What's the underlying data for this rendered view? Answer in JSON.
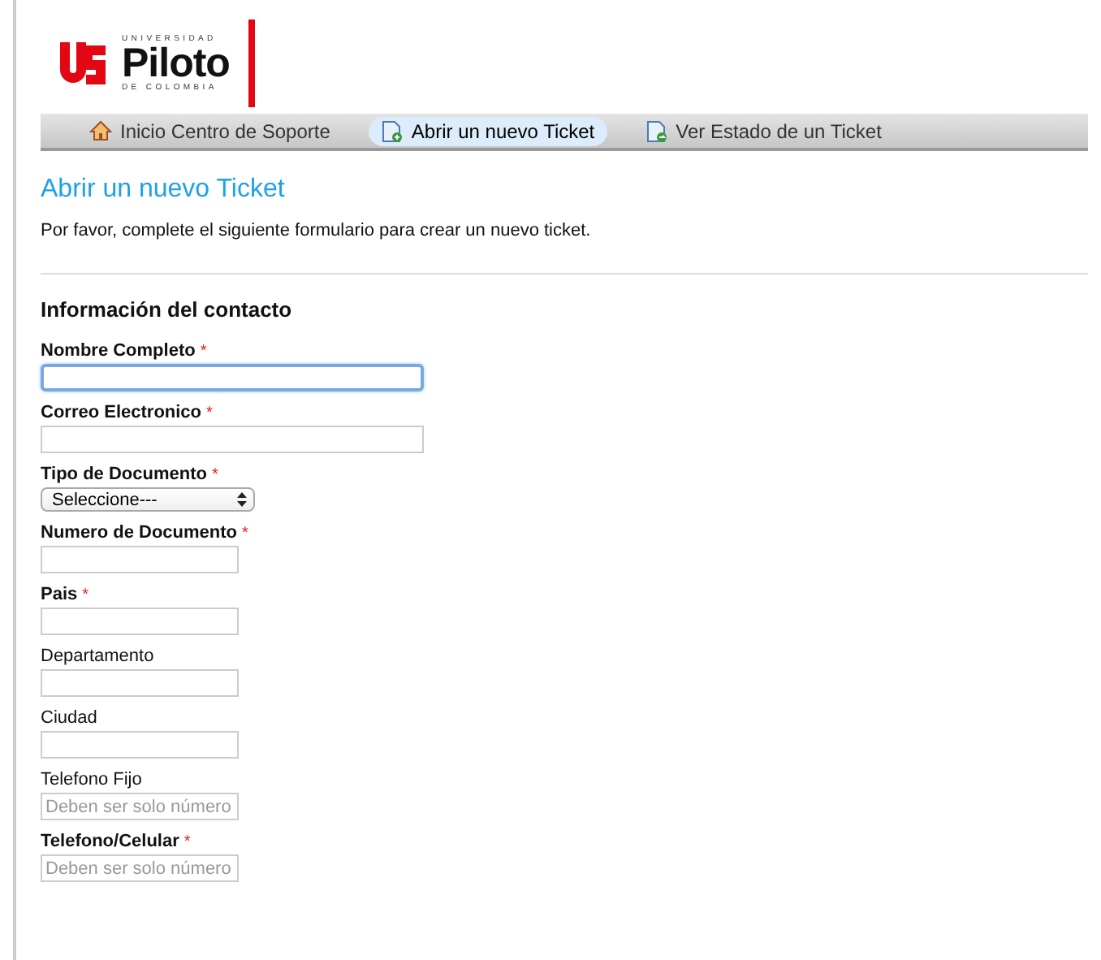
{
  "logo": {
    "top": "UNIVERSIDAD",
    "name": "Piloto",
    "bottom": "DE COLOMBIA"
  },
  "nav": [
    {
      "label": "Inicio Centro de Soporte",
      "kind": "home",
      "selected": false
    },
    {
      "label": "Abrir un nuevo Ticket",
      "kind": "new",
      "selected": true
    },
    {
      "label": "Ver Estado de un Ticket",
      "kind": "status",
      "selected": false
    }
  ],
  "page_title": "Abrir un nuevo Ticket",
  "intro": "Por favor, complete el siguiente formulario para crear un nuevo ticket.",
  "section_title": "Información del contacto",
  "fields": [
    {
      "label": "Nombre Completo",
      "required": true,
      "kind": "wide",
      "focused": true
    },
    {
      "label": "Correo Electronico",
      "required": true,
      "kind": "wide",
      "focused": false
    },
    {
      "label": "Tipo de Documento",
      "required": true,
      "kind": "select",
      "value": "Seleccione---",
      "focused": false
    },
    {
      "label": "Numero de Documento",
      "required": true,
      "kind": "narrow",
      "focused": false
    },
    {
      "label": "Pais",
      "required": true,
      "kind": "narrow",
      "focused": false
    },
    {
      "label": "Departamento",
      "required": false,
      "kind": "narrow",
      "focused": false
    },
    {
      "label": "Ciudad",
      "required": false,
      "kind": "narrow",
      "focused": false
    },
    {
      "label": "Telefono Fijo",
      "required": false,
      "kind": "narrow",
      "focused": false,
      "placeholder": "Deben ser solo número"
    },
    {
      "label": "Telefono/Celular",
      "required": true,
      "kind": "narrow",
      "focused": false,
      "placeholder": "Deben ser solo número"
    }
  ],
  "required_mark": "*"
}
